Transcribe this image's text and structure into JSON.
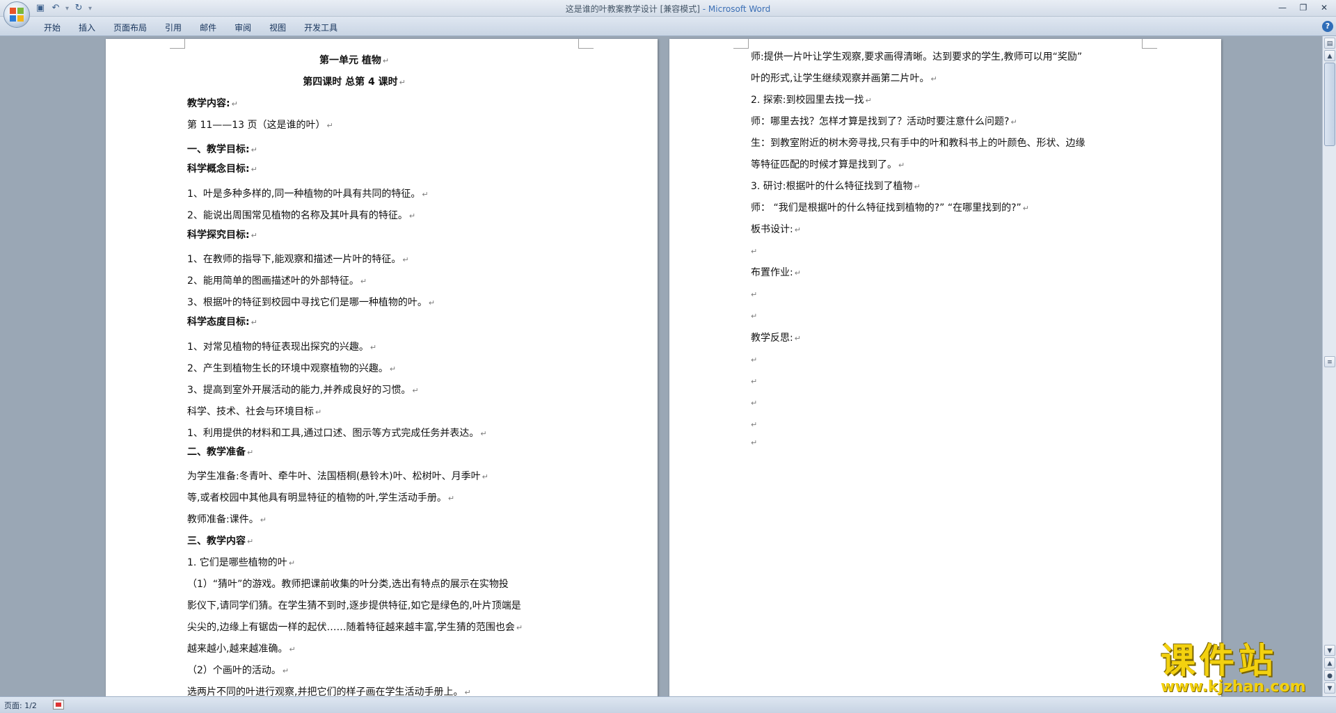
{
  "window": {
    "title": "这是谁的叶教案教学设计 [兼容模式]",
    "app_suffix": " - Microsoft Word",
    "min_icon": "minimize-icon",
    "max_icon": "maximize-icon",
    "close_icon": "close-icon"
  },
  "qat": {
    "save_icon": "save-icon",
    "undo_icon": "undo-icon",
    "redo_icon": "redo-icon",
    "customize_icon": "dropdown-icon"
  },
  "ribbon": {
    "tabs": [
      "开始",
      "插入",
      "页面布局",
      "引用",
      "邮件",
      "审阅",
      "视图",
      "开发工具"
    ],
    "help_glyph": "?"
  },
  "page1": {
    "lines": [
      "第一单元      植物",
      "第四课时    总第 4 课时",
      "教学内容:",
      "第 11——13 页（这是谁的叶）",
      "一、教学目标:",
      "科学概念目标:",
      "1、叶是多种多样的,同一种植物的叶具有共同的特征。",
      "2、能说出周围常见植物的名称及其叶具有的特征。",
      "科学探究目标:",
      "1、在教师的指导下,能观察和描述一片叶的特征。",
      "2、能用简单的图画描述叶的外部特征。",
      "3、根据叶的特征到校园中寻找它们是哪一种植物的叶。",
      "科学态度目标:",
      "1、对常见植物的特征表现出探究的兴趣。",
      "2、产生到植物生长的环境中观察植物的兴趣。",
      "3、提高到室外开展活动的能力,并养成良好的习惯。",
      "科学、技术、社会与环境目标",
      "1、利用提供的材料和工具,通过口述、图示等方式完成任务并表达。",
      "二、教学准备",
      "为学生准备:冬青叶、牵牛叶、法国梧桐(悬铃木)叶、松树叶、月季叶",
      "等,或者校园中其他具有明显特征的植物的叶,学生活动手册。",
      "教师准备:课件。",
      "三、教学内容",
      "1. 它们是哪些植物的叶",
      "（1）“猜叶”的游戏。教师把课前收集的叶分类,选出有特点的展示在实物投",
      "影仪下,请同学们猜。在学生猜不到时,逐步提供特征,如它是绿色的,叶片顶端是",
      "尖尖的,边缘上有锯齿一样的起伏……随着特征越来越丰富,学生猜的范围也会",
      "越来越小,越来越准确。",
      "（2）个画叶的活动。",
      "选两片不同的叶进行观察,并把它们的样子画在学生活动手册上。"
    ]
  },
  "page2": {
    "lines": [
      "师:提供一片叶让学生观察,要求画得清晰。达到要求的学生,教师可以用“奖励”",
      "叶的形式,让学生继续观察并画第二片叶。",
      "2. 探索:到校园里去找一找",
      "师：哪里去找？怎样才算是找到了？活动时要注意什么问题?",
      "生：到教室附近的树木旁寻找,只有手中的叶和教科书上的叶颜色、形状、边缘",
      "等特征匹配的时候才算是找到了。",
      "3. 研讨:根据叶的什么特征找到了植物",
      "师：  “我们是根据叶的什么特征找到植物的?”  “在哪里找到的?”",
      "板书设计:",
      "布置作业:",
      "教学反思:"
    ]
  },
  "status": {
    "page_indicator": "页面: 1/2"
  },
  "watermark": {
    "title": "课件站",
    "url": "www.kjzhan.com"
  }
}
